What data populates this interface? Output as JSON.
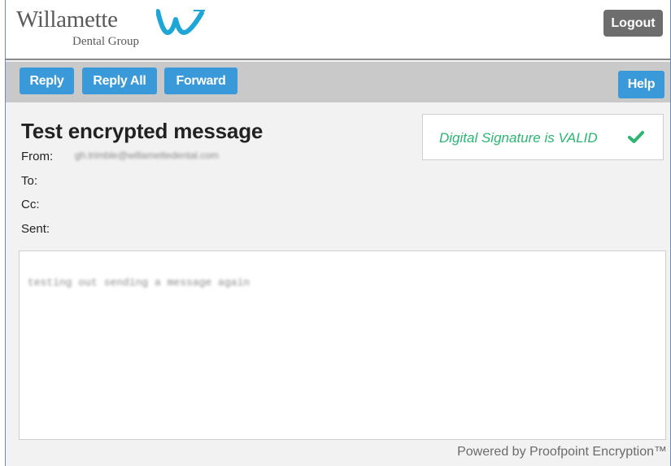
{
  "header": {
    "logo_name": "Willamette",
    "logo_sub": "Dental Group",
    "logout_label": "Logout"
  },
  "toolbar": {
    "reply_label": "Reply",
    "reply_all_label": "Reply All",
    "forward_label": "Forward",
    "help_label": "Help"
  },
  "message": {
    "subject": "Test encrypted message",
    "from_label": "From:",
    "from_value": "gh.trimble@willamettedental.com",
    "to_label": "To:",
    "cc_label": "Cc:",
    "sent_label": "Sent:",
    "body_text": "testing out sending a message again"
  },
  "signature": {
    "status_text": "Digital Signature is VALID",
    "icon": "checkmark-icon",
    "color": "#2bb673"
  },
  "footer": {
    "powered_by": "Powered by Proofpoint Encryption™"
  },
  "colors": {
    "button_blue": "#3a9ad9",
    "logout_gray": "#6d6d6d",
    "toolbar_gray": "#c9c9c9",
    "logo_blue": "#1ea7d6"
  }
}
